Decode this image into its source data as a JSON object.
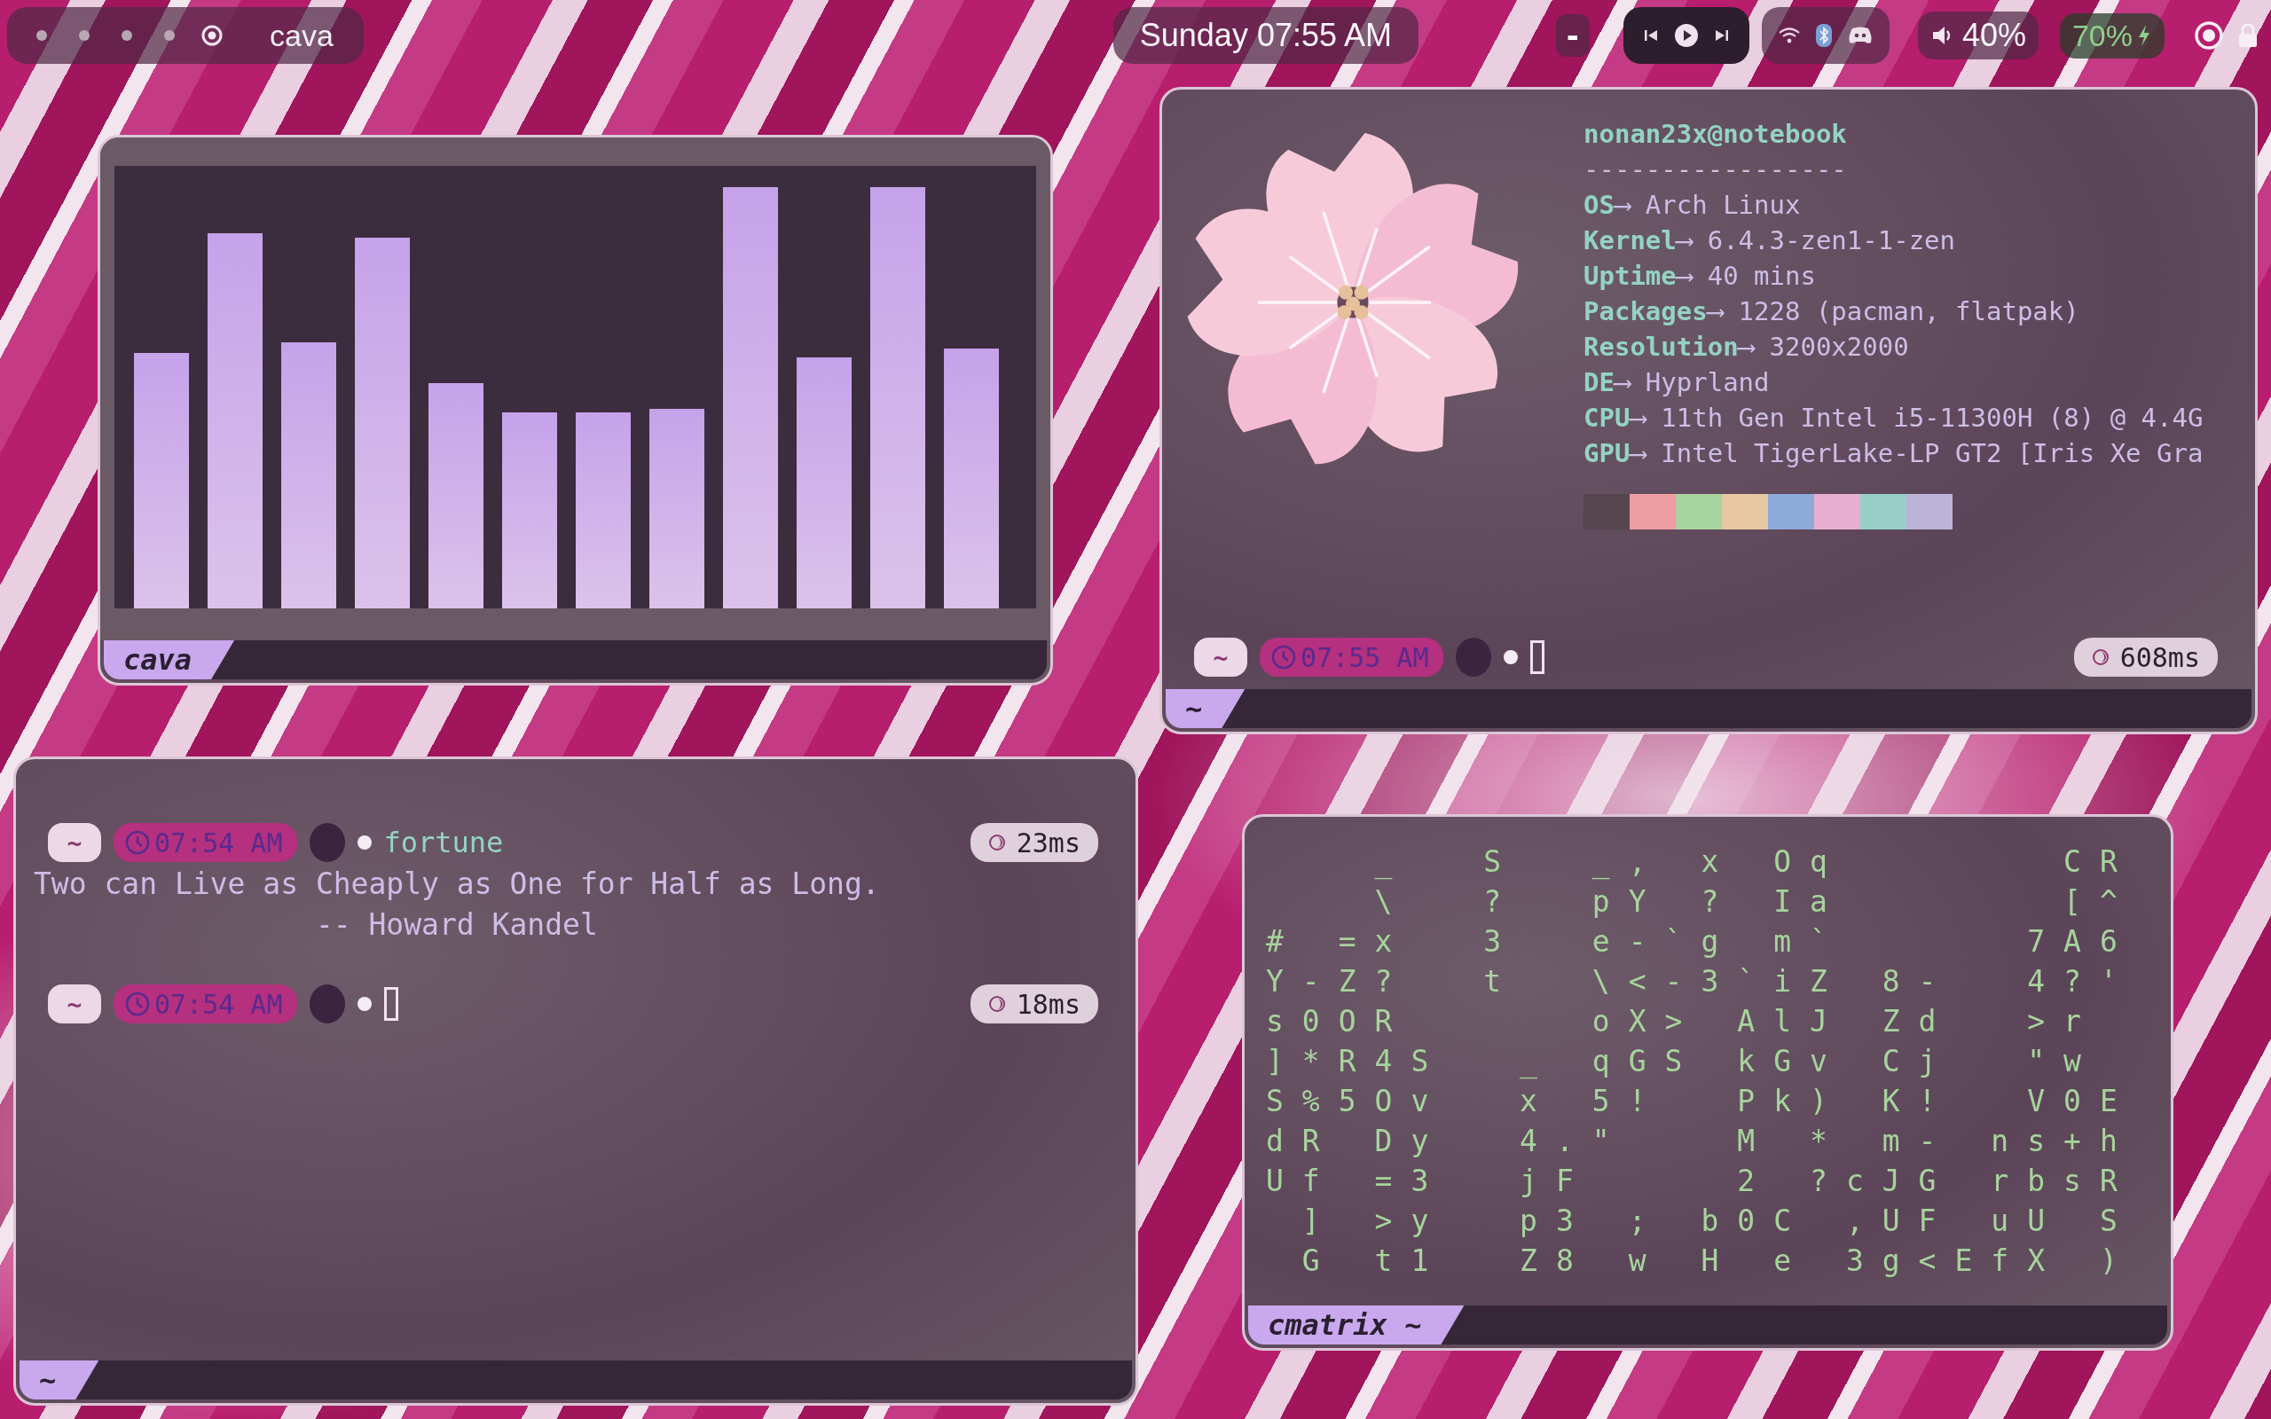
{
  "top_bar": {
    "workspaces": [
      {
        "selected": false
      },
      {
        "selected": false
      },
      {
        "selected": false
      },
      {
        "selected": false
      },
      {
        "selected": true
      }
    ],
    "window_title": "cava",
    "clock": "Sunday 07:55 AM",
    "separator": "-",
    "volume": "40%",
    "battery": "70%"
  },
  "windows": [
    {
      "kind": "cava",
      "tab_label": "cava"
    },
    {
      "kind": "neofetch",
      "user_host": "nonan23x@notebook",
      "rule": "-----------------",
      "info": [
        {
          "key": "OS",
          "value": "⟶ Arch Linux"
        },
        {
          "key": "Kernel",
          "value": "⟶ 6.4.3-zen1-1-zen"
        },
        {
          "key": "Uptime",
          "value": "⟶ 40 mins"
        },
        {
          "key": "Packages",
          "value": "⟶ 1228 (pacman, flatpak)"
        },
        {
          "key": "Resolution",
          "value": "⟶ 3200x2000"
        },
        {
          "key": "DE",
          "value": "⟶ Hyprland"
        },
        {
          "key": "CPU",
          "value": "⟶ 11th Gen Intel i5-11300H (8) @ 4.4G"
        },
        {
          "key": "GPU",
          "value": "⟶ Intel TigerLake-LP GT2 [Iris Xe Gra"
        }
      ],
      "palette": [
        {
          "color": "#54454f"
        },
        {
          "color": "#ee9ea2"
        },
        {
          "color": "#a8d4a0"
        },
        {
          "color": "#e8c8a2"
        },
        {
          "color": "#8eaad8"
        },
        {
          "color": "#e8aed2"
        },
        {
          "color": "#98d0c8"
        },
        {
          "color": "#bcb4d8"
        }
      ],
      "prompt": {
        "dir": "~",
        "time": "07:55 AM",
        "cursor": true,
        "duration": "608ms"
      },
      "tab_label": "~"
    },
    {
      "kind": "terminal",
      "blocks": [
        {
          "prompt": {
            "dir": "~",
            "time": "07:54 AM",
            "command": "fortune",
            "duration": "23ms"
          },
          "output": [
            "Two can Live as Cheaply as One for Half as Long.",
            "                -- Howard Kandel"
          ]
        },
        {
          "prompt": {
            "dir": "~",
            "time": "07:54 AM",
            "cursor": true,
            "duration": "18ms"
          }
        }
      ],
      "tab_label": "~"
    },
    {
      "kind": "cmatrix",
      "rows": [
        "   _  S  _, x Oq      CR",
        "   \\  ?  pY ? Ia      [^",
        "# =x  3  e-`g m`     7A6",
        "Y-Z?  t  \\<-3`iZ 8-  4?'",
        "s0OR     oX> AlJ Zd  >r",
        "]*R4S  _ qGS kGv Cj  \"w",
        "S%5Ov  x 5!  Pk) K!  V0E",
        "dR Dy  4.\"   M * m- ns+h",
        "Uf =3  jF    2 ?cJG rbsR",
        " ] >y  p3 ; b0C ,UF uU S",
        " G t1  Z8 w H e 3g<EfX )"
      ],
      "tab_label": "cmatrix ~"
    }
  ]
}
